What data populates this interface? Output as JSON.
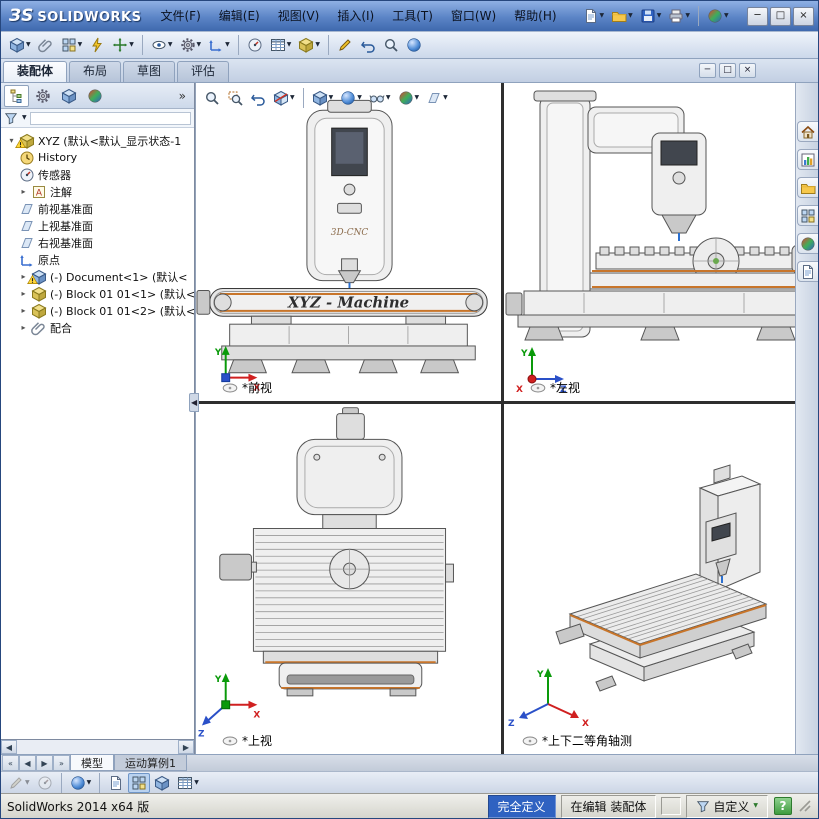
{
  "colors": {
    "titlebar_top": "#8fb0e4",
    "titlebar_bottom": "#3f69ae",
    "accent_orange": "#c8752a",
    "status_defined_bg": "#2f62c1",
    "viewport_divider": "#2e2e2e",
    "selection_blue": "#3a6ecc"
  },
  "ui": {
    "dd": "▼",
    "expand_more": "»",
    "minimize": "─",
    "maximize": "□",
    "close": "×",
    "collapse": "◀",
    "tree_open": "▾",
    "tree_closed": "▸",
    "scroll_left": "◀",
    "scroll_right": "▶",
    "nav": [
      "«",
      "◀",
      "▶",
      "»"
    ]
  },
  "titlebar": {
    "logo_mark": "ЗS",
    "logo_text": "SOLIDWORKS",
    "menus": [
      "文件(F)",
      "编辑(E)",
      "视图(V)",
      "插入(I)",
      "工具(T)",
      "窗口(W)",
      "帮助(H)"
    ]
  },
  "command_tabs": [
    {
      "label": "装配体"
    },
    {
      "label": "布局"
    },
    {
      "label": "草图"
    },
    {
      "label": "评估"
    }
  ],
  "feature_panel": {
    "tree": {
      "root": "XYZ (默认<默认_显示状态-1",
      "items": [
        {
          "label": "History"
        },
        {
          "label": "传感器"
        },
        {
          "label": "注解"
        },
        {
          "label": "前视基准面"
        },
        {
          "label": "上视基准面"
        },
        {
          "label": "右视基准面"
        },
        {
          "label": "原点"
        },
        {
          "label": "(-) Document<1> (默认<"
        },
        {
          "label": "(-) Block 01 01<1> (默认<"
        },
        {
          "label": "(-) Block 01 01<2> (默认<"
        },
        {
          "label": "配合"
        }
      ]
    }
  },
  "viewport": {
    "panes": [
      {
        "label": "*前视"
      },
      {
        "label": "*左视"
      },
      {
        "label": "*上视"
      },
      {
        "label": "*上下二等角轴测"
      }
    ],
    "machine_text": "XYZ - Machine",
    "head_text": "3D-CNC",
    "axis": {
      "x": "X",
      "y": "Y",
      "z": "Z"
    }
  },
  "bottom_tabs": {
    "tabs": [
      {
        "label": "模型"
      },
      {
        "label": "运动算例1"
      }
    ]
  },
  "statusbar": {
    "app": "SolidWorks 2014 x64 版",
    "defined": "完全定义",
    "editing": "在编辑 装配体",
    "custom": "自定义",
    "help": "?"
  }
}
